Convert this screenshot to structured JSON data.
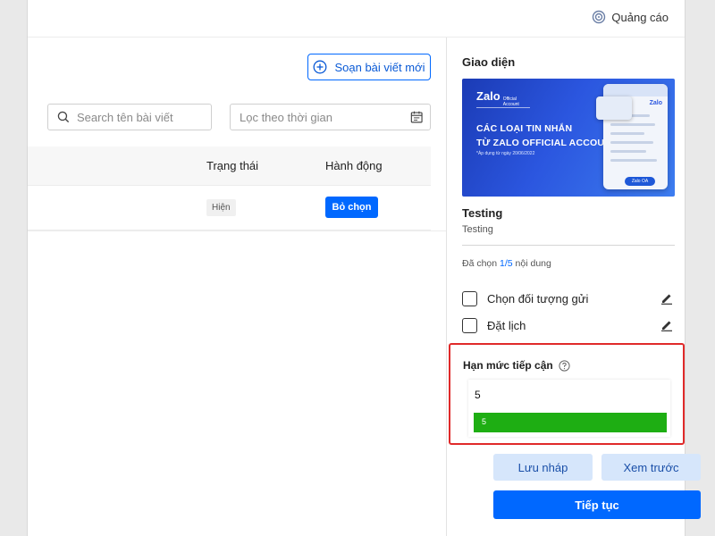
{
  "topbar": {
    "ads_label": "Quảng cáo"
  },
  "left": {
    "compose_label": "Soạn bài viết mới",
    "search_placeholder": "Search tên bài viết",
    "date_filter_placeholder": "Lọc theo thời gian",
    "table": {
      "headers": {
        "status": "Trạng thái",
        "action": "Hành động"
      },
      "rows": [
        {
          "status": "Hiện",
          "action_label": "Bỏ chọn"
        }
      ]
    }
  },
  "right": {
    "section_title": "Giao diện",
    "banner": {
      "logo": "Zalo",
      "logo_sub": "Official Account",
      "headline_1": "CÁC LOẠI TIN NHẮN",
      "headline_2": "TỪ ZALO OFFICIAL ACCOUNT",
      "note": "*Áp dụng từ ngày 20/06/2022",
      "phone_brand": "Zalo",
      "pill": "Zalo OA"
    },
    "post_title": "Testing",
    "post_subtitle": "Testing",
    "selected": {
      "prefix": "Đã chọn ",
      "count": "1/5",
      "suffix": " nội dung"
    },
    "options": [
      {
        "label": "Chọn đối tượng gửi",
        "checked": false
      },
      {
        "label": "Đặt lịch",
        "checked": false
      }
    ],
    "reach": {
      "title": "Hạn mức tiếp cận",
      "value": "5",
      "bar_label": "5",
      "fill_fraction": 1.0,
      "fill_color": "#1eae13"
    },
    "buttons": {
      "draft": "Lưu nháp",
      "preview": "Xem trước",
      "continue": "Tiếp tục"
    }
  },
  "colors": {
    "primary": "#0068ff",
    "highlight_border": "#e02a2a",
    "reach_fill": "#1eae13"
  }
}
